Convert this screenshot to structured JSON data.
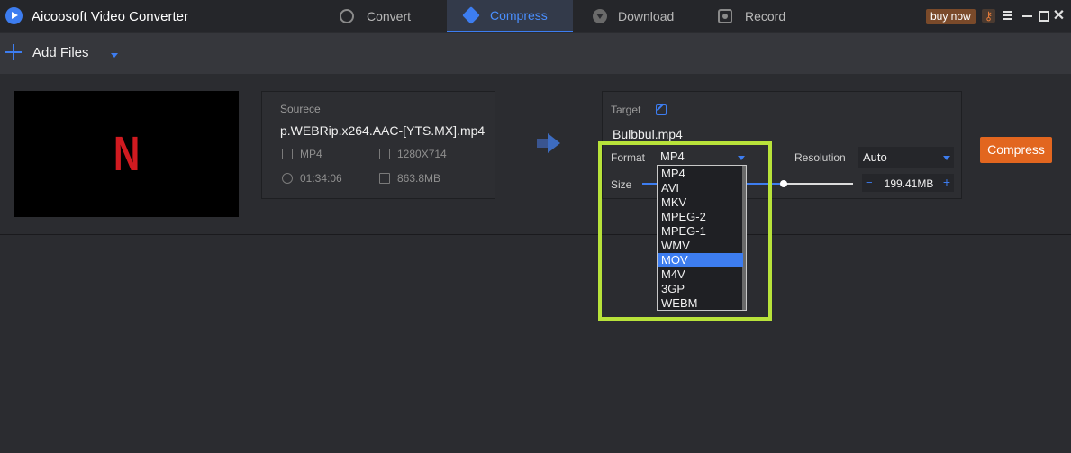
{
  "app": {
    "title": "Aicoosoft Video Converter"
  },
  "nav": {
    "tabs": [
      {
        "label": "Convert",
        "icon": "convert-icon"
      },
      {
        "label": "Compress",
        "icon": "compress-icon",
        "active": true
      },
      {
        "label": "Download",
        "icon": "download-icon"
      },
      {
        "label": "Record",
        "icon": "record-icon"
      }
    ],
    "buy_label": "buy now"
  },
  "toolbar": {
    "add_files_label": "Add Files"
  },
  "source": {
    "heading": "Sourece",
    "filename": "p.WEBRip.x264.AAC-[YTS.MX].mp4",
    "format": "MP4",
    "resolution": "1280X714",
    "duration": "01:34:06",
    "size": "863.8MB"
  },
  "target": {
    "heading": "Target",
    "filename": "Bulbbul.mp4",
    "format_label": "Format",
    "format_value": "MP4",
    "resolution_label": "Resolution",
    "resolution_value": "Auto",
    "size_label": "Size",
    "size_value": "199.41MB",
    "size_fraction": 0.67
  },
  "actions": {
    "compress_label": "Compress"
  },
  "format_dropdown": {
    "options": [
      "MP4",
      "AVI",
      "MKV",
      "MPEG-2",
      "MPEG-1",
      "WMV",
      "MOV",
      "M4V",
      "3GP",
      "WEBM"
    ],
    "highlighted": "MOV"
  },
  "colors": {
    "accent": "#3d7df0",
    "compress_button": "#e2661f",
    "highlight_box": "#b8e23a"
  }
}
